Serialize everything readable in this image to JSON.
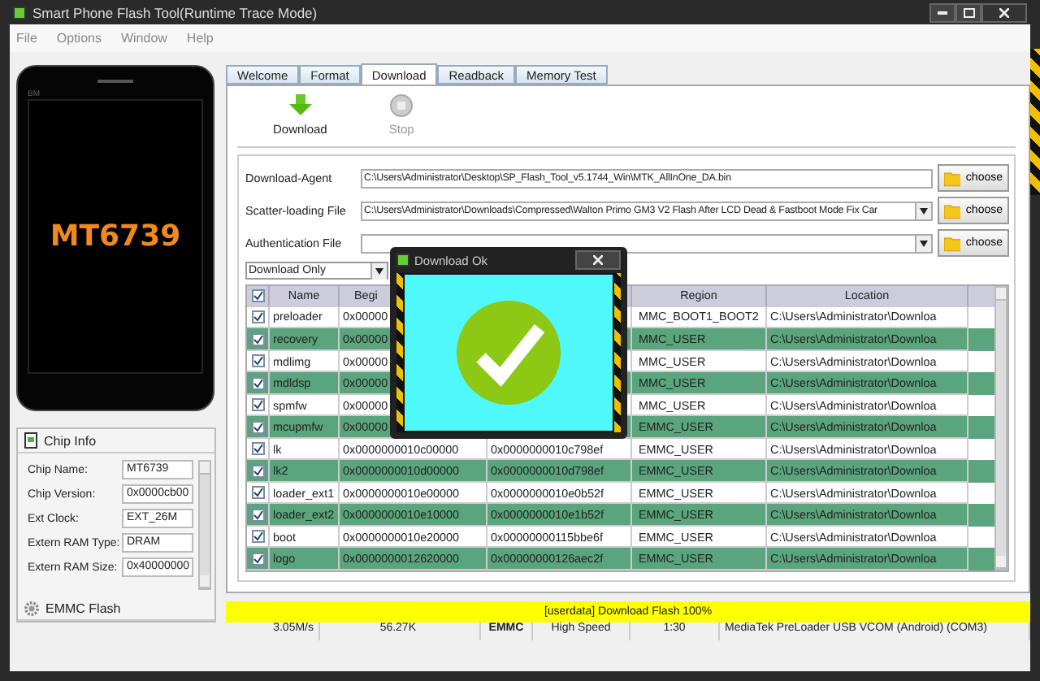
{
  "window": {
    "title": "Smart Phone Flash Tool(Runtime Trace Mode)"
  },
  "menu": [
    "File",
    "Options",
    "Window",
    "Help"
  ],
  "phone": {
    "brand": "BM",
    "chip": "MT6739"
  },
  "chip_info": {
    "title": "Chip Info",
    "fields": [
      {
        "label": "Chip Name:",
        "value": "MT6739"
      },
      {
        "label": "Chip Version:",
        "value": "0x0000cb00"
      },
      {
        "label": "Ext Clock:",
        "value": "EXT_26M"
      },
      {
        "label": "Extern RAM Type:",
        "value": "DRAM"
      },
      {
        "label": "Extern RAM Size:",
        "value": "0x40000000"
      }
    ]
  },
  "emmc_panel": {
    "title": "EMMC Flash"
  },
  "tabs": [
    {
      "label": "Welcome",
      "selected": false
    },
    {
      "label": "Format",
      "selected": false
    },
    {
      "label": "Download",
      "selected": true
    },
    {
      "label": "Readback",
      "selected": false
    },
    {
      "label": "Memory Test",
      "selected": false
    }
  ],
  "toolbar": [
    {
      "kind": "download",
      "label": "Download",
      "disabled": false
    },
    {
      "kind": "stop",
      "label": "Stop",
      "disabled": true
    }
  ],
  "files": [
    {
      "label": "Download-Agent",
      "value": "C:\\Users\\Administrator\\Desktop\\SP_Flash_Tool_v5.1744_Win\\MTK_AllInOne_DA.bin",
      "dropdown": false,
      "button": "choose"
    },
    {
      "label": "Scatter-loading File",
      "value": "C:\\Users\\Administrator\\Downloads\\Compressed\\Walton Primo GM3 V2 Flash After LCD Dead & Fastboot Mode Fix Car",
      "dropdown": true,
      "button": "choose"
    },
    {
      "label": "Authentication File",
      "dropdown": true,
      "button": "choose"
    }
  ],
  "mode": "Download Only",
  "table": {
    "columns": [
      {
        "label": "Name"
      },
      {
        "label": "Begi"
      },
      {},
      {
        "label": "Region"
      },
      {
        "label": "Location"
      }
    ],
    "header_checked": true,
    "rows": [
      {
        "checked": true,
        "name": "preloader",
        "begin": "0x00000",
        "region": "MMC_BOOT1_BOOT2",
        "location": "C:\\Users\\Administrator\\Downloa"
      },
      {
        "checked": true,
        "name": "recovery",
        "begin": "0x00000",
        "region": "MMC_USER",
        "location": "C:\\Users\\Administrator\\Downloa"
      },
      {
        "checked": true,
        "name": "mdlimg",
        "begin": "0x00000",
        "region": "MMC_USER",
        "location": "C:\\Users\\Administrator\\Downloa"
      },
      {
        "checked": true,
        "name": "mdldsp",
        "begin": "0x00000",
        "region": "MMC_USER",
        "location": "C:\\Users\\Administrator\\Downloa"
      },
      {
        "checked": true,
        "name": "spmfw",
        "begin": "0x00000",
        "region": "MMC_USER",
        "location": "C:\\Users\\Administrator\\Downloa"
      },
      {
        "checked": true,
        "name": "mcupmfw",
        "begin": "0x00000",
        "region": "EMMC_USER",
        "location": "C:\\Users\\Administrator\\Downloa"
      },
      {
        "checked": true,
        "name": "lk",
        "begin": "0x0000000010c00000",
        "end": "0x0000000010c798ef",
        "region": "EMMC_USER",
        "location": "C:\\Users\\Administrator\\Downloa"
      },
      {
        "checked": true,
        "name": "lk2",
        "begin": "0x0000000010d00000",
        "end": "0x0000000010d798ef",
        "region": "EMMC_USER",
        "location": "C:\\Users\\Administrator\\Downloa"
      },
      {
        "checked": true,
        "name": "loader_ext1",
        "begin": "0x0000000010e00000",
        "end": "0x0000000010e0b52f",
        "region": "EMMC_USER",
        "location": "C:\\Users\\Administrator\\Downloa"
      },
      {
        "checked": true,
        "name": "loader_ext2",
        "begin": "0x0000000010e10000",
        "end": "0x0000000010e1b52f",
        "region": "EMMC_USER",
        "location": "C:\\Users\\Administrator\\Downloa"
      },
      {
        "checked": true,
        "name": "boot",
        "begin": "0x0000000010e20000",
        "end": "0x00000000115bbe6f",
        "region": "EMMC_USER",
        "location": "C:\\Users\\Administrator\\Downloa"
      },
      {
        "checked": true,
        "name": "logo",
        "begin": "0x0000000012620000",
        "end": "0x00000000126aec2f",
        "region": "EMMC_USER",
        "location": "C:\\Users\\Administrator\\Downloa"
      }
    ]
  },
  "dialog": {
    "title": "Download Ok"
  },
  "progress": {
    "message": "[userdata] Download Flash 100%",
    "level": 1
  },
  "status": [
    {
      "text": "3.05M/s",
      "bold": false
    },
    {
      "text": "56.27K",
      "bold": false
    },
    {
      "text": "EMMC",
      "bold": true
    },
    {
      "text": "High Speed",
      "bold": false
    },
    {
      "text": "1:30",
      "bold": false
    },
    {
      "text": "MediaTek PreLoader USB VCOM (Android) (COM3)",
      "bold": false
    }
  ]
}
